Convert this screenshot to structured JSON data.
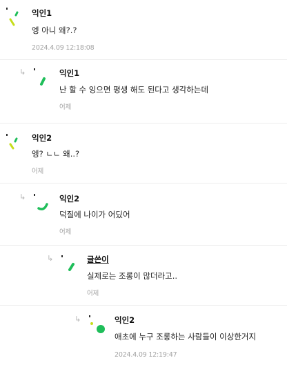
{
  "comments": [
    {
      "author": "익인1",
      "text": "엥 아니 왜?.?",
      "meta": "2024.4.09 12:18:08",
      "depth": 0
    },
    {
      "author": "익인1",
      "text": "난 할 수 잉으면 평생 해도 된다고 생각하는데",
      "meta": "어제",
      "depth": 1
    },
    {
      "author": "익인2",
      "text": "엥? ㄴㄴ 왜..?",
      "meta": "어제",
      "depth": 0
    },
    {
      "author": "익인2",
      "text": "덕질에 나이가 어딨어",
      "meta": "어제",
      "depth": 1
    },
    {
      "author": "글쓴이",
      "text": "실제로는 조롱이 많더라고..",
      "meta": "어제",
      "depth": 2
    },
    {
      "author": "익인2",
      "text": "애초에 누구 조롱하는 사람들이 이상한거지",
      "meta": "2024.4.09 12:19:47",
      "depth": 3
    }
  ],
  "icons": {
    "reply_arrow": "↳"
  },
  "colors": {
    "accent_green": "#1fbe5a",
    "accent_lime": "#c6dd1a"
  }
}
